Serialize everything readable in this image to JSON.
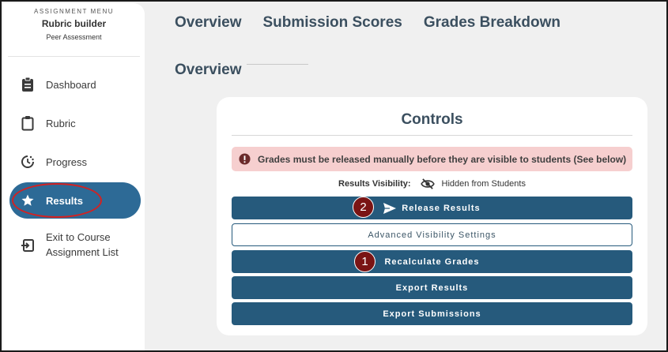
{
  "sidebar": {
    "kicker": "ASSIGNMENT MENU",
    "title": "Rubric builder",
    "subtitle": "Peer Assessment",
    "items": [
      {
        "label": "Dashboard",
        "icon": "clipboard-filled-icon"
      },
      {
        "label": "Rubric",
        "icon": "clipboard-outline-icon"
      },
      {
        "label": "Progress",
        "icon": "progress-icon"
      },
      {
        "label": "Results",
        "icon": "star-icon",
        "active": true
      },
      {
        "label": "Exit to Course Assignment List",
        "label_line1": "Exit to Course",
        "label_line2": "Assignment List",
        "icon": "exit-icon"
      }
    ]
  },
  "tabs": [
    "Overview",
    "Submission Scores",
    "Grades Breakdown"
  ],
  "section": {
    "title": "Overview"
  },
  "controls": {
    "title": "Controls",
    "alert": "Grades must be released manually before they are visible to students (See below)",
    "visibility_label": "Results Visibility:",
    "visibility_value": "Hidden from Students",
    "buttons": {
      "release": "Release Results",
      "advanced": "Advanced Visibility Settings",
      "recalculate": "Recalculate Grades",
      "export_results": "Export Results",
      "export_submissions": "Export Submissions"
    }
  },
  "annotations": {
    "step1": "1",
    "step2": "2"
  },
  "colors": {
    "accent": "#265a7c",
    "active_nav": "#2d6a96",
    "alert_bg": "#f6cfcf",
    "annotation": "#d32222",
    "badge": "#7a1414"
  }
}
